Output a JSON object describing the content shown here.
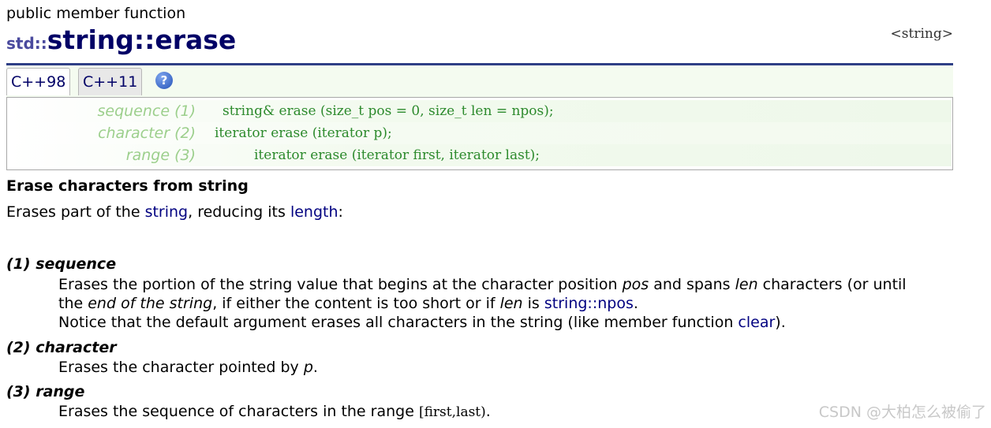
{
  "header": {
    "kind": "public member function",
    "title_ns": "std::",
    "title_class": "string",
    "title_sep": "::",
    "title_fn": "erase",
    "header_file": "<string>"
  },
  "tabs": [
    {
      "label": "C++98"
    },
    {
      "label": "C++11"
    }
  ],
  "help_icon_glyph": "?",
  "prototypes": [
    {
      "label": "sequence (1)",
      "code": "string& erase (size_t pos = 0, size_t len = npos);"
    },
    {
      "label": "character (2)",
      "code": "iterator erase (iterator p);"
    },
    {
      "label": "range (3)",
      "code": "iterator erase (iterator first, iterator last);"
    }
  ],
  "intro": {
    "title": "Erase characters from string",
    "lead_before": "Erases part of the ",
    "lead_link1": "string",
    "lead_mid": ", reducing its ",
    "lead_link2": "length",
    "lead_after": ":"
  },
  "params": [
    {
      "term": "(1) sequence",
      "l1_a": "Erases the portion of the string value that begins at the character position ",
      "l1_em1": "pos",
      "l1_b": " and spans ",
      "l1_em2": "len",
      "l1_c": " characters (or until",
      "l2_a": "the ",
      "l2_em1": "end of the string",
      "l2_b": ", if either the content is too short or if ",
      "l2_em2": "len",
      "l2_c": " is ",
      "l2_link": "string::npos",
      "l2_d": ".",
      "l3_a": "Notice that the default argument erases all characters in the string (like member function ",
      "l3_link": "clear",
      "l3_b": ")."
    },
    {
      "term": "(2) character",
      "l1_a": "Erases the character pointed by ",
      "l1_em1": "p",
      "l1_b": "."
    },
    {
      "term": "(3) range",
      "l1_a": "Erases the sequence of characters in the range ",
      "l1_code": "[first,last)",
      "l1_b": "."
    }
  ],
  "watermark": "CSDN @大柏怎么被偷了"
}
